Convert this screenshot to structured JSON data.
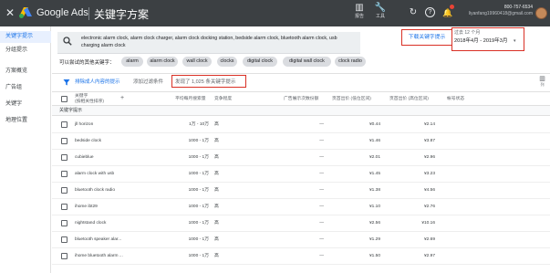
{
  "topbar": {
    "close_glyph": "✕",
    "brand": "Google Ads",
    "page_title": "关键字方案",
    "icons": [
      {
        "name": "reports-icon",
        "glyph": "▥",
        "label": "报告"
      },
      {
        "name": "tools-icon",
        "glyph": "🔧",
        "label": "工具"
      }
    ],
    "refresh_glyph": "↻",
    "help_glyph": "?",
    "bell_glyph": "🔔",
    "account": {
      "phone": "800-757-6534",
      "email": "liyanfang19960418@gmail.com"
    },
    "colors": {
      "bg": "#3c4043",
      "badge": "#ea4335"
    }
  },
  "sidebar": {
    "items": [
      {
        "label": "关键字提示",
        "active": true
      },
      {
        "label": "分组提示",
        "active": false
      },
      {
        "label": "方案概览",
        "active": false
      },
      {
        "label": "广告组",
        "active": false
      },
      {
        "label": "关键字",
        "active": false
      },
      {
        "label": "地理位置",
        "active": false
      }
    ]
  },
  "search": {
    "keywords_text": "electronic alarm clock,  alarm clock charger,  alarm clock docking station,  bedside alarm clock,  bluetooth alarm clock,  usb charging alarm clock"
  },
  "toolbar": {
    "download_label": "下载关键字提示",
    "date_label": "过去 12 个月",
    "date_value": "2018年4月 - 2019年3月",
    "date_chevron": "▾"
  },
  "suggestions": {
    "label": "可以尝试的其他关键字：",
    "chips": [
      "alarm",
      "alarm clock",
      "wall clock",
      "clocks",
      "digital clock",
      "digital wall clock",
      "clock radio"
    ]
  },
  "filters": {
    "exclude_label": "排除成人内容的提示",
    "add_filter_label": "添加过滤条件",
    "found_label": "发现了 1,025 条关键字提示",
    "columns_label": "列"
  },
  "table": {
    "headers": {
      "keyword": "关键字\n(按相关性排序)",
      "add": "+",
      "avg_searches": "平均每月搜索量",
      "competition": "竞争程度",
      "impression_share": "广告展示次数份额",
      "bid_low": "页首出价 (低位区间)",
      "bid_high": "页首出价 (高位区间)",
      "account_status": "帐号状态"
    },
    "section": "关键字提示",
    "rows": [
      {
        "keyword": "jll horizon",
        "searches": "1万 - 10万",
        "competition": "高",
        "share": "—",
        "low": "¥0.44",
        "high": "¥2.14"
      },
      {
        "keyword": "bedside clock",
        "searches": "1000 - 1万",
        "competition": "高",
        "share": "—",
        "low": "¥1.46",
        "high": "¥3.87"
      },
      {
        "keyword": "cubieblue",
        "searches": "1000 - 1万",
        "competition": "高",
        "share": "—",
        "low": "¥2.01",
        "high": "¥2.96"
      },
      {
        "keyword": "alarm clock with usb",
        "searches": "1000 - 1万",
        "competition": "高",
        "share": "—",
        "low": "¥1.45",
        "high": "¥3.23"
      },
      {
        "keyword": "bluetooth clock radio",
        "searches": "1000 - 1万",
        "competition": "高",
        "share": "—",
        "low": "¥1.38",
        "high": "¥4.56"
      },
      {
        "keyword": "ihome ibt29",
        "searches": "1000 - 1万",
        "competition": "高",
        "share": "—",
        "low": "¥1.10",
        "high": "¥2.76"
      },
      {
        "keyword": "nightstand clock",
        "searches": "1000 - 1万",
        "competition": "高",
        "share": "—",
        "low": "¥2.56",
        "high": "¥10.16"
      },
      {
        "keyword": "bluetooth speaker alar...",
        "searches": "1000 - 1万",
        "competition": "高",
        "share": "—",
        "low": "¥1.29",
        "high": "¥2.69"
      },
      {
        "keyword": "ihome bluetooth alarm ...",
        "searches": "1000 - 1万",
        "competition": "高",
        "share": "—",
        "low": "¥1.50",
        "high": "¥2.97"
      }
    ]
  },
  "colors": {
    "accent": "#1a73e8",
    "highlight_border": "#d93025",
    "active_nav_bg": "#e8f0fe"
  }
}
